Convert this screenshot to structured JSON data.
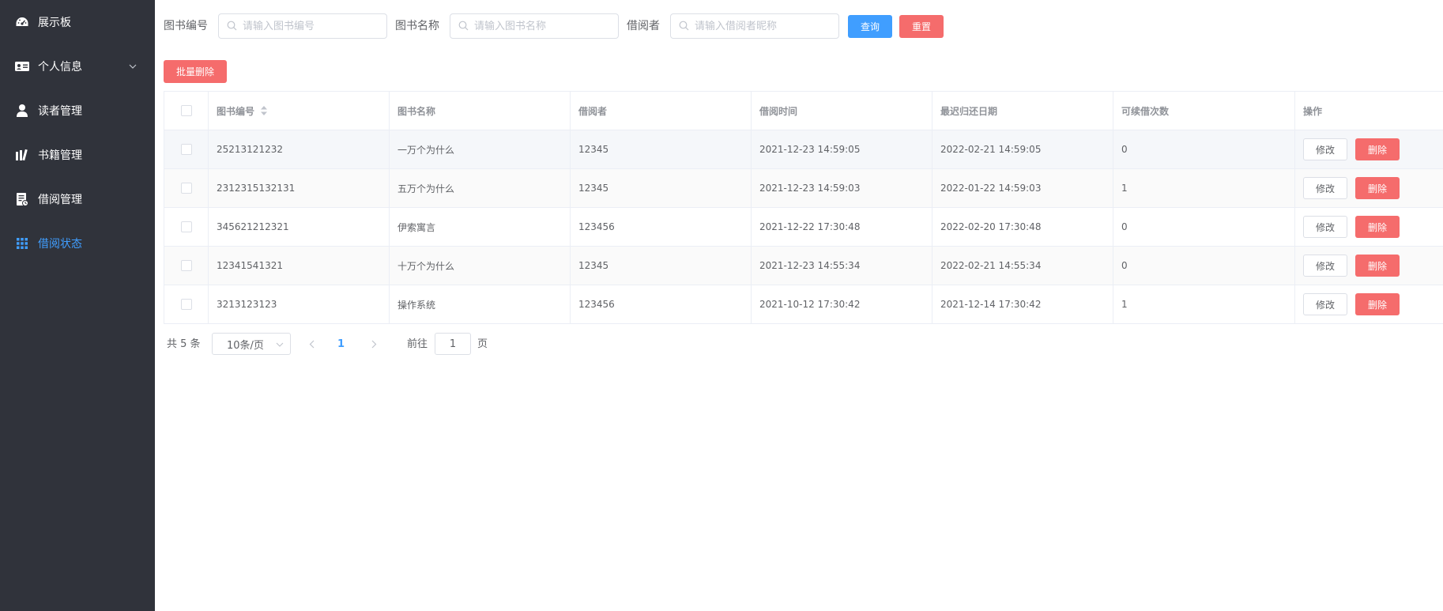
{
  "sidebar": {
    "items": [
      {
        "label": "展示板",
        "icon": "dashboard-icon",
        "active": false
      },
      {
        "label": "个人信息",
        "icon": "id-card-icon",
        "active": false,
        "has_submenu": true
      },
      {
        "label": "读者管理",
        "icon": "user-icon",
        "active": false
      },
      {
        "label": "书籍管理",
        "icon": "books-icon",
        "active": false
      },
      {
        "label": "借阅管理",
        "icon": "borrow-doc-icon",
        "active": false
      },
      {
        "label": "借阅状态",
        "icon": "grid-icon",
        "active": true
      }
    ]
  },
  "search": {
    "book_id_label": "图书编号",
    "book_id_placeholder": "请输入图书编号",
    "book_id_value": "",
    "book_name_label": "图书名称",
    "book_name_placeholder": "请输入图书名称",
    "book_name_value": "",
    "borrower_label": "借阅者",
    "borrower_placeholder": "请输入借阅者昵称",
    "borrower_value": "",
    "query_label": "查询",
    "reset_label": "重置"
  },
  "toolbar": {
    "batch_delete_label": "批量删除"
  },
  "table": {
    "columns": [
      "图书编号",
      "图书名称",
      "借阅者",
      "借阅时间",
      "最迟归还日期",
      "可续借次数",
      "操作"
    ],
    "rows": [
      {
        "book_id": "25213121232",
        "book_name": "一万个为什么",
        "borrower": "12345",
        "borrow_time": "2021-12-23 14:59:05",
        "due_date": "2022-02-21 14:59:05",
        "renew_count": "0"
      },
      {
        "book_id": "2312315132131",
        "book_name": "五万个为什么",
        "borrower": "12345",
        "borrow_time": "2021-12-23 14:59:03",
        "due_date": "2022-01-22 14:59:03",
        "renew_count": "1"
      },
      {
        "book_id": "345621212321",
        "book_name": "伊索寓言",
        "borrower": "123456",
        "borrow_time": "2021-12-22 17:30:48",
        "due_date": "2022-02-20 17:30:48",
        "renew_count": "0"
      },
      {
        "book_id": "12341541321",
        "book_name": "十万个为什么",
        "borrower": "12345",
        "borrow_time": "2021-12-23 14:55:34",
        "due_date": "2022-02-21 14:55:34",
        "renew_count": "0"
      },
      {
        "book_id": "3213123123",
        "book_name": "操作系统",
        "borrower": "123456",
        "borrow_time": "2021-10-12 17:30:42",
        "due_date": "2021-12-14 17:30:42",
        "renew_count": "1"
      }
    ],
    "edit_label": "修改",
    "delete_label": "删除"
  },
  "pagination": {
    "total_text": "共 5 条",
    "page_size": "10条/页",
    "current_page": "1",
    "goto_label": "前往",
    "goto_value": "1",
    "page_suffix": "页"
  },
  "colors": {
    "sidebar_bg": "#30333b",
    "primary": "#409eff",
    "danger": "#f56c6c"
  }
}
